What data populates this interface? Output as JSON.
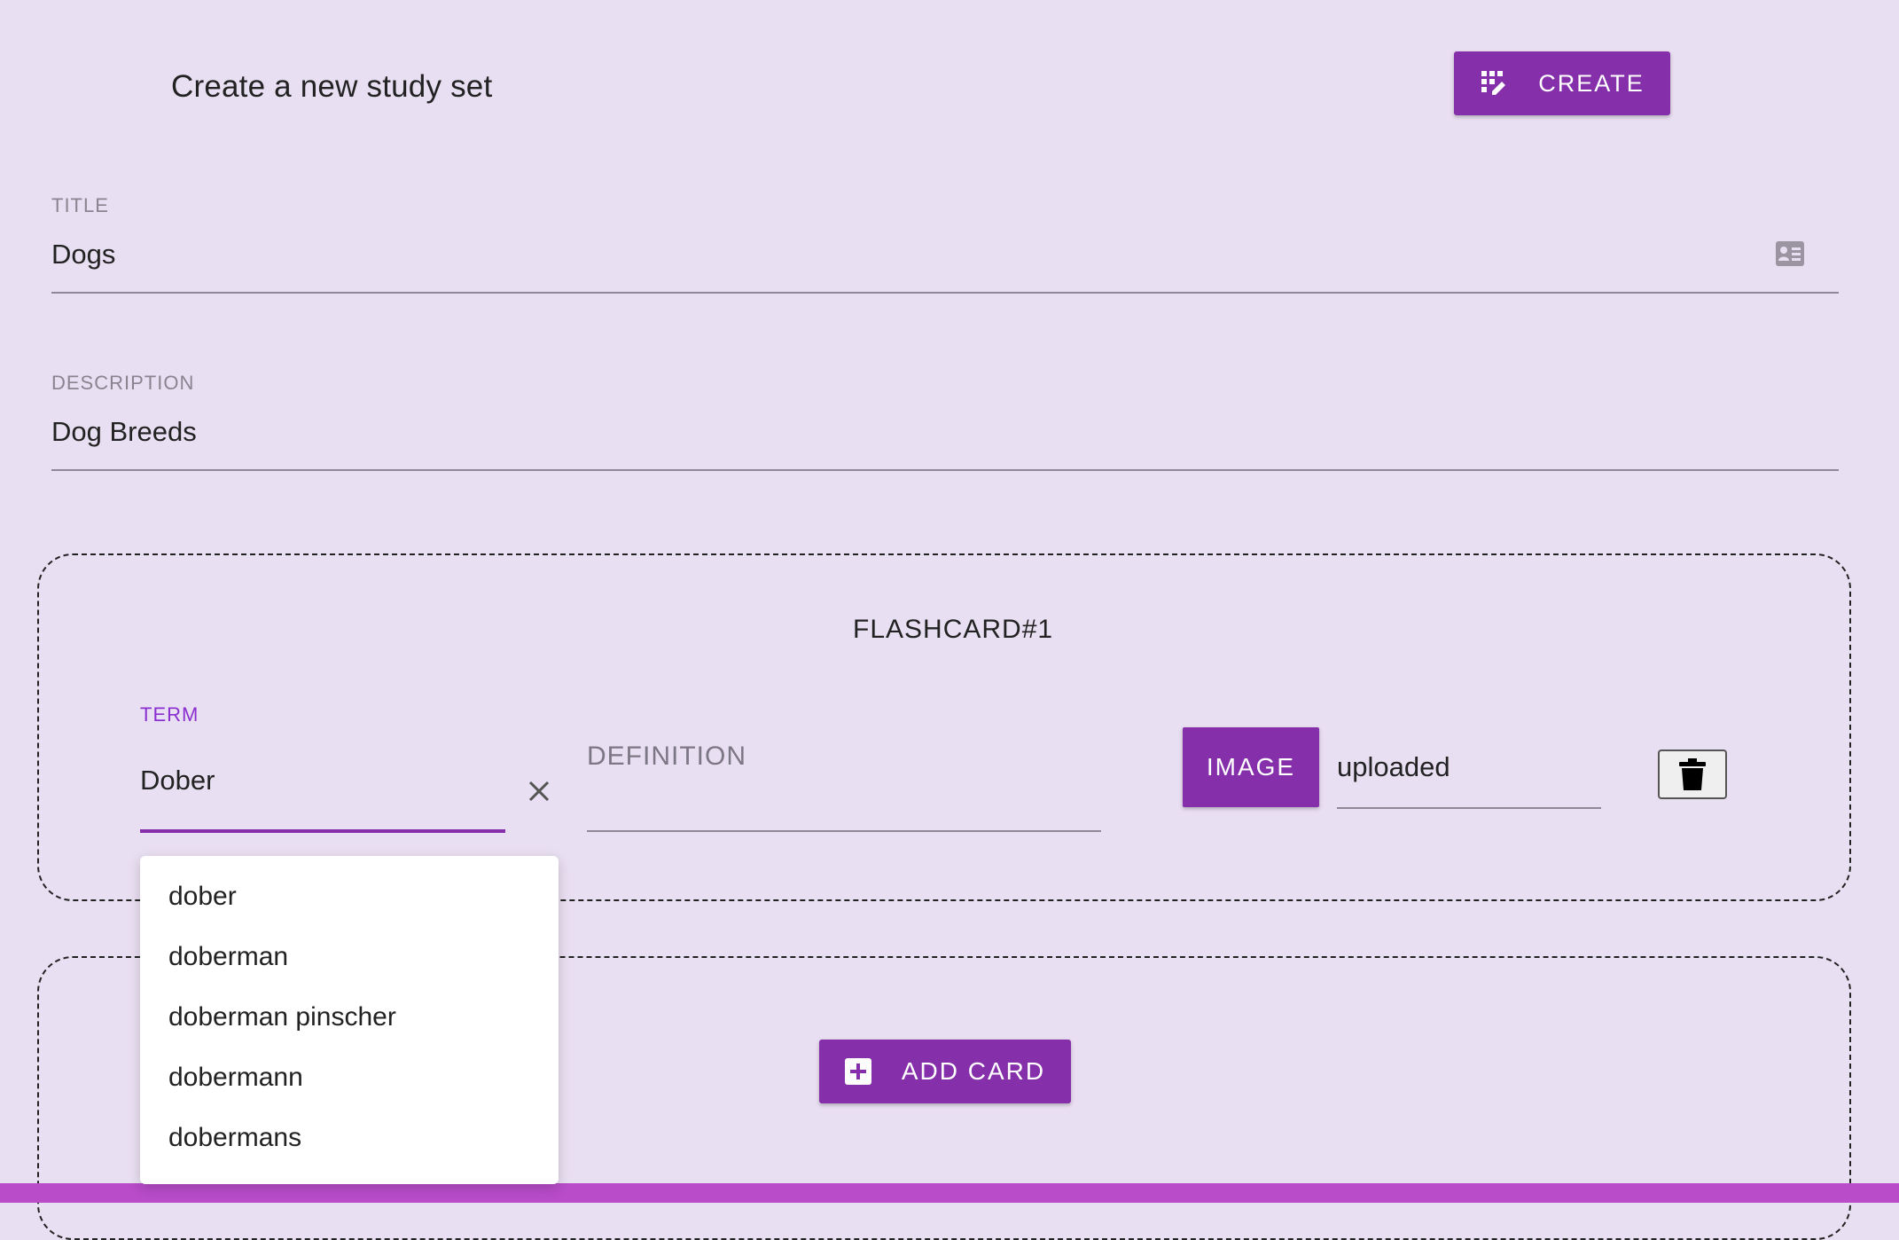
{
  "header": {
    "title": "Create a new study set",
    "create_label": "CREATE"
  },
  "title_field": {
    "label": "TITLE",
    "value": "Dogs"
  },
  "description_field": {
    "label": "DESCRIPTION",
    "value": "Dog Breeds"
  },
  "flashcard": {
    "title": "FLASHCARD#1",
    "term_label": "TERM",
    "term_value": "Dober",
    "definition_label": "DEFINITION",
    "image_label": "IMAGE",
    "upload_status": "uploaded"
  },
  "autocomplete": {
    "items": [
      "dober",
      "doberman",
      "doberman pinscher",
      "dobermann",
      "dobermans"
    ]
  },
  "add_card": {
    "label": "ADD CARD"
  },
  "colors": {
    "background": "#e9dff2",
    "accent": "#8530aa",
    "focus": "#8a2fd0",
    "bottom_bar": "#b84cc9"
  },
  "icons": {
    "create": "grid-edit-icon",
    "title_field": "contact-card-icon",
    "clear": "close-icon",
    "delete": "trash-icon",
    "add_card": "plus-box-icon"
  }
}
